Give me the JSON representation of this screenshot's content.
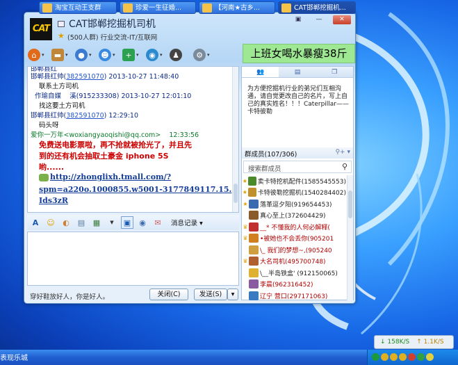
{
  "window": {
    "title": "CAT邯郸挖掘机司机",
    "subtitle": "(500人群) 行业交流-IT/互联网",
    "logo_text": "CAT",
    "controls": [
      "▣",
      "—",
      "✕"
    ]
  },
  "ad_banner": "上班女喝水暴瘦38斤",
  "chat": {
    "scroll_line": "邯郸县红",
    "messages": [
      {
        "sender": "邯郸县红帅(",
        "uid": "382591070",
        "time": ") 2013-10-27 11:48:40",
        "text": "联系土方司机"
      },
      {
        "sender": "作瑜自媒",
        "uid": "",
        "time": "溪(915233308) 2013-10-27 12:01:10",
        "text": "找这要土方司机"
      },
      {
        "sender": "邯郸县红帅(",
        "uid": "382591070",
        "time": ") 12:29:10",
        "text": "码头呀"
      },
      {
        "sender": "爱你一万年<woxiangyaoqishi@qq.com>",
        "uid": "",
        "time": "12:33:56",
        "text": ""
      }
    ],
    "promo_lines": [
      "免费送电影票啦，再不抢就被抢光了，并且先",
      "到的还有机会抽取土豪金 iphone 5S",
      "哟......"
    ],
    "url_lines": [
      "http://zhonglixh.tmall.com/?",
      "spm=a220o.1000855.w5001-3177849117.15.",
      "Ids3zR"
    ]
  },
  "format_bar": {
    "items": [
      "A",
      "☺",
      "◐",
      "▤",
      "▦",
      "▼",
      "▣",
      "◉",
      "✉"
    ],
    "history": "消息记录 ▾"
  },
  "bottom": {
    "footer": "穿好鞋放好人，你是好人。",
    "close_btn": "关闭(C)",
    "send_btn": "发送(S)",
    "send_dd": "▾"
  },
  "right_panel": {
    "notice": "为方便挖掘机行业的弟兄们互相沟通，请自觉更改自己的名片，写上自己的真实姓名！！！Caterpillar——卡特彼勒",
    "members_label": "群成员(107/306)",
    "member_search_placeholder": "搜索群成员",
    "members": [
      {
        "name": "卖卡特挖机配件(1585545553)",
        "role": "★",
        "color": "#4a8a2a",
        "red": false
      },
      {
        "name": "卡特彼勒挖掘机(1540284402)",
        "role": "★",
        "color": "#c0902a",
        "red": false
      },
      {
        "name": "落革逗夕阳(919654453)",
        "role": "★",
        "color": "#3a6ab0",
        "red": false
      },
      {
        "name": "真心至上(372604429)",
        "role": "",
        "color": "#8a5a2a",
        "red": false
      },
      {
        "name": "__* 不懂我的人何必解释(",
        "role": "♛",
        "color": "#c03030",
        "red": true
      },
      {
        "name": "•被她也不会丢你(905201",
        "role": "♛",
        "color": "#d08020",
        "red": true
      },
      {
        "name": "\\_ 我们的梦想~,(905240",
        "role": "",
        "color": "#d0a040",
        "red": true
      },
      {
        "name": "大名司机(495700748)",
        "role": "♛",
        "color": "#b06030",
        "red": true
      },
      {
        "name": "\\__半岛铁盒' (912150065)",
        "role": "",
        "color": "#e0b030",
        "red": false
      },
      {
        "name": "李晨(962316452)",
        "role": "",
        "color": "#8a5aa0",
        "red": true
      },
      {
        "name": "辽宁 营口(297171063)",
        "role": "",
        "color": "#3a7ac0",
        "red": true
      }
    ]
  },
  "network": {
    "down": "↓ 158K/S",
    "up": "↑ 1.1K/S"
  },
  "taskbar": {
    "start_text": "表现乐城",
    "buttons": [
      "淘宝互动王支群",
      "珍爱一生征婚...",
      "【河南★古乡...",
      "CAT邯郸挖掘机..."
    ]
  }
}
